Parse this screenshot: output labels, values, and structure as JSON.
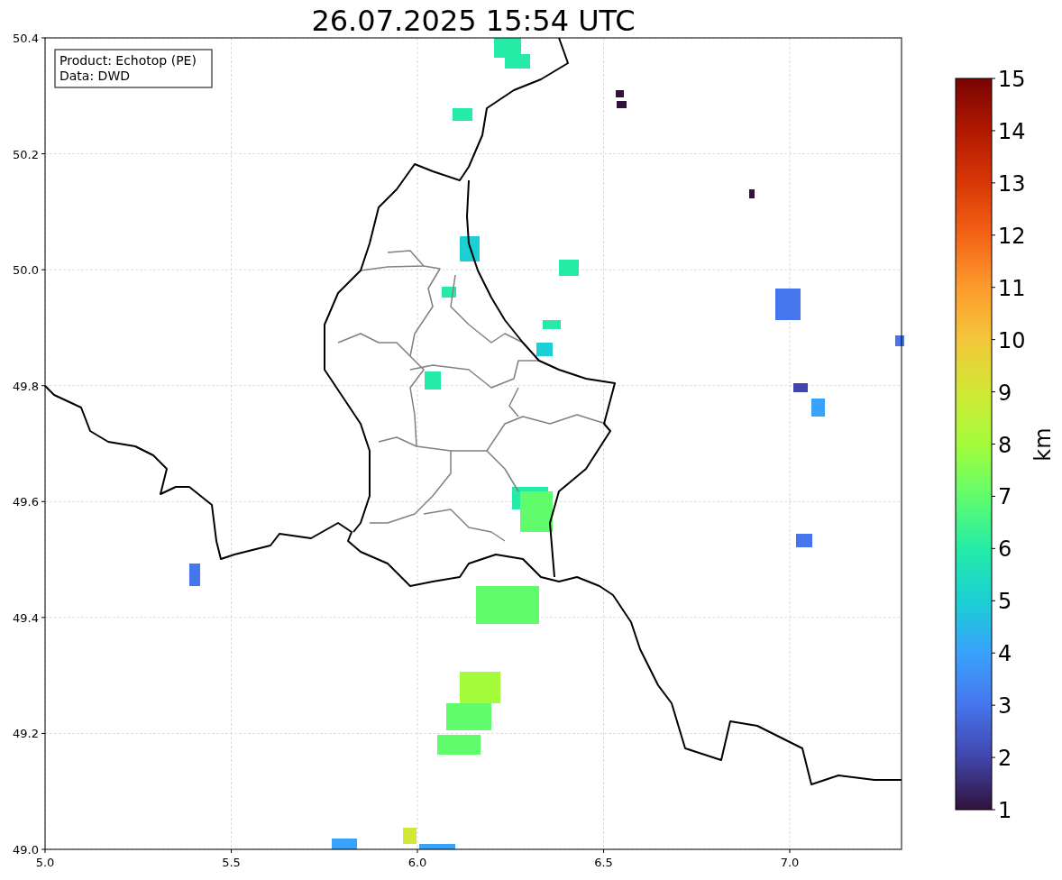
{
  "title": "26.07.2025 15:54 UTC",
  "info_box": {
    "lines": [
      "Product: Echotop (PE)",
      "Data: DWD"
    ]
  },
  "map": {
    "xticks": [
      "5.0",
      "5.5",
      "6.0",
      "6.5",
      "7.0"
    ],
    "yticks": [
      "50.4",
      "50.2",
      "50.0",
      "49.8",
      "49.6",
      "49.4",
      "49.2",
      "49.0"
    ]
  },
  "colorbar": {
    "label": "km",
    "ticks": [
      "15",
      "14",
      "13",
      "12",
      "11",
      "10",
      "9",
      "8",
      "7",
      "6",
      "5",
      "4",
      "3",
      "2",
      "1"
    ]
  }
}
